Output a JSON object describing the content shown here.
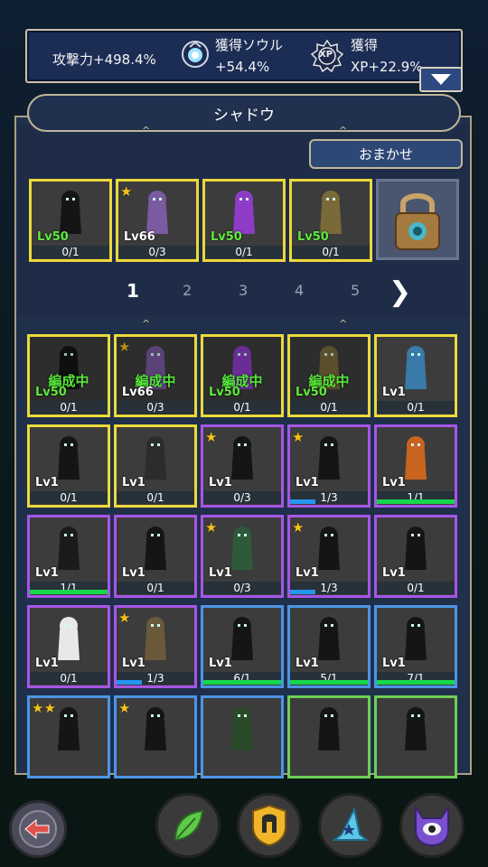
{
  "stats": {
    "attack": "攻撃力+498.4%",
    "soul_label": "獲得ソウル",
    "soul_value": "+54.4%",
    "xp_label": "獲得",
    "xp_value": "XP+22.9%",
    "xp_icon_text": "XP"
  },
  "panel": {
    "title": "シャドウ",
    "auto_button": "おまかせ"
  },
  "team": [
    {
      "level": "Lv50",
      "count": "0/1",
      "icon": "reaper-silhouette"
    },
    {
      "level": "Lv66",
      "count": "0/3",
      "icon": "demon-mage",
      "star": "★"
    },
    {
      "level": "Lv50",
      "count": "0/1",
      "icon": "purple-knight"
    },
    {
      "level": "Lv50",
      "count": "0/1",
      "icon": "armored-beast"
    },
    {
      "locked": true,
      "icon": "lock-icon"
    }
  ],
  "pagination": {
    "pages": [
      "1",
      "2",
      "3",
      "4",
      "5"
    ],
    "active": 0,
    "next_icon": "chevron-right-icon"
  },
  "formed_label": "編成中",
  "grid": [
    {
      "level": "Lv50",
      "count": "0/1",
      "border": "y",
      "formed": true,
      "icon": "reaper-silhouette"
    },
    {
      "level": "Lv66",
      "count": "0/3",
      "border": "y",
      "formed": true,
      "star": "★",
      "icon": "demon-mage"
    },
    {
      "level": "Lv50",
      "count": "0/1",
      "border": "y",
      "formed": true,
      "icon": "purple-knight"
    },
    {
      "level": "Lv50",
      "count": "0/1",
      "border": "y",
      "formed": true,
      "icon": "armored-beast"
    },
    {
      "level": "Lv1",
      "count": "0/1",
      "border": "y",
      "icon": "frost-golem"
    },
    {
      "level": "Lv1",
      "count": "0/1",
      "border": "y",
      "icon": "plague-doctor"
    },
    {
      "level": "Lv1",
      "count": "0/1",
      "border": "y",
      "icon": "flame-king"
    },
    {
      "level": "Lv1",
      "count": "0/3",
      "border": "p",
      "star": "★",
      "icon": "hooded-shade"
    },
    {
      "level": "Lv1",
      "count": "1/3",
      "border": "p",
      "star": "★",
      "progress": 0.33,
      "bar": "blue",
      "icon": "shadow-beetle"
    },
    {
      "level": "Lv1",
      "count": "1/1",
      "border": "p",
      "progress": 1,
      "bar": "green",
      "icon": "flame-hound"
    },
    {
      "level": "Lv1",
      "count": "1/1",
      "border": "p",
      "progress": 1,
      "bar": "green",
      "icon": "red-eye-shade"
    },
    {
      "level": "Lv1",
      "count": "0/1",
      "border": "p",
      "icon": "portal-knight"
    },
    {
      "level": "Lv1",
      "count": "0/3",
      "border": "p",
      "star": "★",
      "icon": "green-mist-spirit"
    },
    {
      "level": "Lv1",
      "count": "1/3",
      "border": "p",
      "star": "★",
      "progress": 0.33,
      "bar": "blue",
      "icon": "stone-golem"
    },
    {
      "level": "Lv1",
      "count": "0/1",
      "border": "p",
      "icon": "shadow-spider"
    },
    {
      "level": "Lv1",
      "count": "0/1",
      "border": "p",
      "icon": "panda"
    },
    {
      "level": "Lv1",
      "count": "1/3",
      "border": "p",
      "star": "★",
      "progress": 0.33,
      "bar": "blue",
      "icon": "skeleton-shaman"
    },
    {
      "level": "Lv1",
      "count": "6/1",
      "border": "b",
      "progress": 1,
      "bar": "green",
      "icon": "shadow-blob"
    },
    {
      "level": "Lv1",
      "count": "5/1",
      "border": "b",
      "progress": 1,
      "bar": "green",
      "icon": "dark-witch"
    },
    {
      "level": "Lv1",
      "count": "7/1",
      "border": "b",
      "progress": 1,
      "bar": "green",
      "icon": "bandit"
    },
    {
      "border": "b",
      "star": "★★",
      "icon": "shadow-cat"
    },
    {
      "border": "b",
      "star": "★",
      "icon": "hooded-rogue"
    },
    {
      "border": "b",
      "icon": "green-imp"
    },
    {
      "border": "g",
      "icon": "shadow-ghost"
    },
    {
      "border": "g",
      "icon": "wide-hat-ghost"
    }
  ],
  "nav": {
    "back": "back-arrow-icon",
    "items": [
      "leaf-icon",
      "helmet-shield-icon",
      "wizard-hat-icon",
      "demon-eye-icon"
    ]
  },
  "colors": {
    "gold": "#ecd93a",
    "purple": "#a656e6",
    "blue": "#4c95e6",
    "green": "#6ccf56",
    "formed_text": "#55e63a",
    "progress_green": "#17d64c",
    "progress_blue": "#2596ee"
  }
}
